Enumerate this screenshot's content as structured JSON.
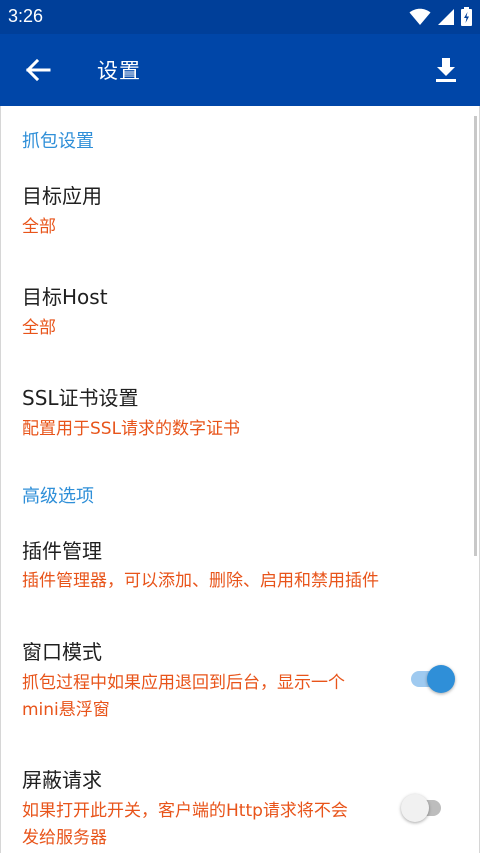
{
  "status_bar": {
    "time": "3:26",
    "icons": [
      "wifi-icon",
      "signal-icon",
      "battery-icon"
    ]
  },
  "app_bar": {
    "title": "设置",
    "back_icon": "arrow-back-icon",
    "action_icon": "download-icon"
  },
  "sections": {
    "capture": {
      "header": "抓包设置",
      "target_app": {
        "title": "目标应用",
        "summary": "全部"
      },
      "target_host": {
        "title": "目标Host",
        "summary": "全部"
      },
      "ssl": {
        "title": "SSL证书设置",
        "summary": "配置用于SSL请求的数字证书"
      }
    },
    "advanced": {
      "header": "高级选项",
      "plugins": {
        "title": "插件管理",
        "summary": "插件管理器，可以添加、删除、启用和禁用插件"
      },
      "window_mode": {
        "title": "窗口模式",
        "summary_line1": "抓包过程中如果应用退回到后台，显示一个",
        "summary_line2": "mini悬浮窗",
        "enabled": true
      },
      "block_requests": {
        "title": "屏蔽请求",
        "summary_line1": "如果打开此开关，客户端的Http请求将不会",
        "summary_line2": "发给服务器",
        "enabled": false
      }
    }
  },
  "colors": {
    "status_bar": "#003f99",
    "app_bar": "#0046a8",
    "accent": "#2f8fd8",
    "summary": "#e8541a"
  }
}
